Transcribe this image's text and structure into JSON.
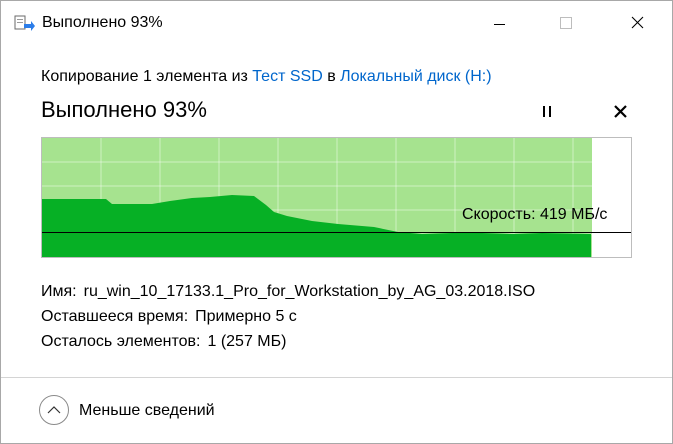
{
  "window": {
    "title": "Выполнено 93%",
    "app_icon": "file-copy-icon",
    "controls": {
      "minimize_icon": "minimize-icon",
      "maximize_icon": "maximize-icon",
      "close_icon": "close-icon"
    }
  },
  "copy": {
    "prefix": "Копирование 1 элемента из",
    "source": "Тест SSD",
    "middle": "в",
    "destination": "Локальный диск (H:)"
  },
  "progress": {
    "headline": "Выполнено 93%",
    "percent": 93,
    "pause_icon": "pause-icon",
    "cancel_icon": "cancel-icon"
  },
  "graph": {
    "speed_label": "Скорость: 419 МБ/с",
    "colors": {
      "done": "#a6e38f",
      "speed": "#06b025",
      "grid": "#ffffff",
      "line": "#000000"
    }
  },
  "details": {
    "name_label": "Имя:",
    "name_value": "ru_win_10_17133.1_Pro_for_Workstation_by_AG_03.2018.ISO",
    "time_label": "Оставшееся время:",
    "time_value": "Примерно 5 с",
    "items_label": "Осталось элементов:",
    "items_value": "1 (257 МБ)"
  },
  "footer": {
    "less_label": "Меньше сведений",
    "less_icon": "chevron-up-icon"
  }
}
